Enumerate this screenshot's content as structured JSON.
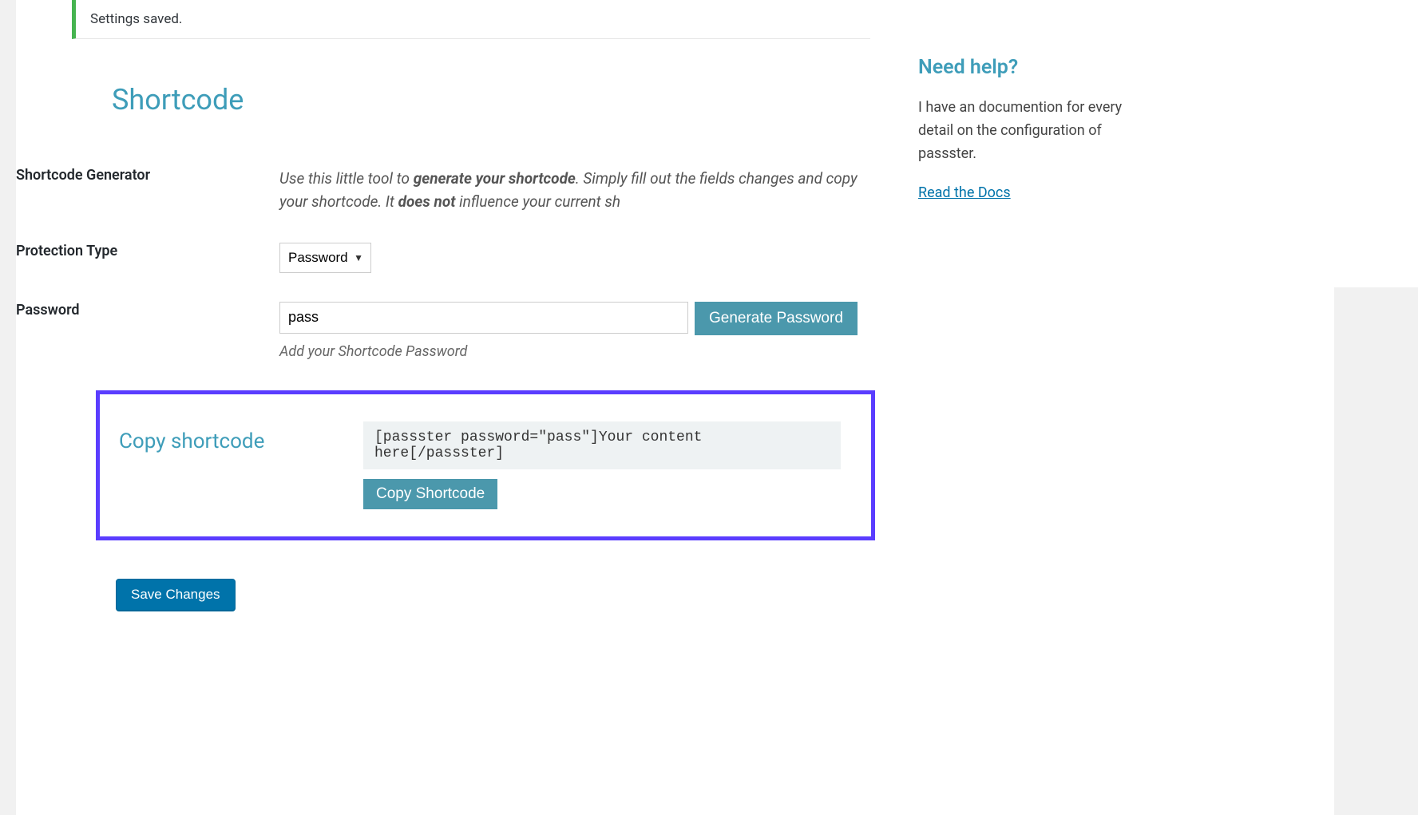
{
  "notice": {
    "text": "Settings saved."
  },
  "heading": "Shortcode",
  "generator": {
    "label": "Shortcode Generator",
    "desc_pre": "Use this little tool to ",
    "desc_bold1": "generate your shortcode",
    "desc_mid": ". Simply fill out the fields changes and copy your shortcode. It ",
    "desc_bold2": "does not",
    "desc_post": " influence your current sh"
  },
  "protection": {
    "label": "Protection Type",
    "selected": "Password"
  },
  "password": {
    "label": "Password",
    "value": "pass",
    "generate_btn": "Generate Password",
    "help": "Add your Shortcode Password"
  },
  "copy": {
    "label": "Copy shortcode",
    "code": "[passster password=\"pass\"]Your content here[/passster]",
    "btn": "Copy Shortcode"
  },
  "save_btn": "Save Changes",
  "sidebar": {
    "heading": "Need help?",
    "text": "I have an documention for every detail on the configuration of passster.",
    "link": "Read the Docs"
  }
}
